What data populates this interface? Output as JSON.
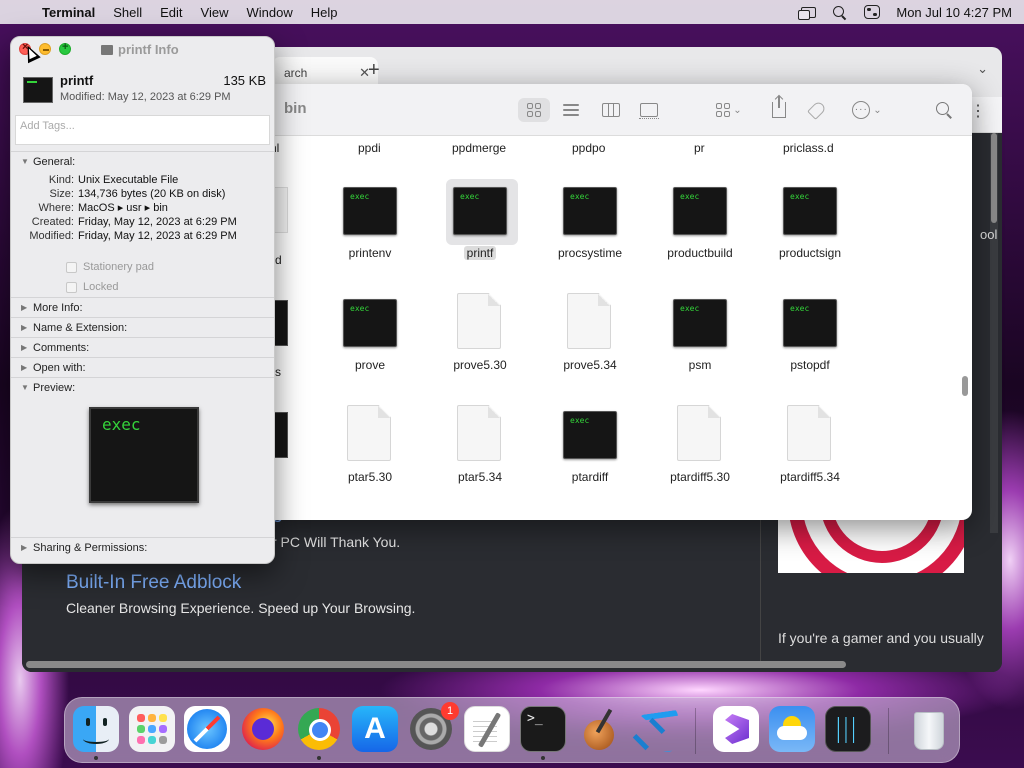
{
  "menubar": {
    "app": "Terminal",
    "items": [
      "Shell",
      "Edit",
      "View",
      "Window",
      "Help"
    ],
    "clock": "Mon Jul 10  4:27 PM"
  },
  "browser": {
    "tab_label": "arch",
    "ad_title_upper": "e",
    "ad_sub_upper": "r PC Will Thank You.",
    "ad_title": "Built-In Free Adblock",
    "ad_sub": "Cleaner Browsing Experience. Speed up Your Browsing.",
    "side_text": "If you're a gamer and you usually",
    "side_text_mid": "ool"
  },
  "finder": {
    "title": "bin",
    "row0_labels": [
      "nl",
      "ppdi",
      "ppdmerge",
      "ppdpo",
      "pr",
      "priclass.d"
    ],
    "items": [
      {
        "label": "printenv",
        "kind": "exec",
        "row": 1,
        "col": 0
      },
      {
        "label": "printf",
        "kind": "exec",
        "row": 1,
        "col": 1,
        "selected": true
      },
      {
        "label": "procsystime",
        "kind": "exec",
        "row": 1,
        "col": 2
      },
      {
        "label": "productbuild",
        "kind": "exec",
        "row": 1,
        "col": 3
      },
      {
        "label": "productsign",
        "kind": "exec",
        "row": 1,
        "col": 4
      },
      {
        "label": "prove",
        "kind": "exec",
        "row": 2,
        "col": 0
      },
      {
        "label": "prove5.30",
        "kind": "doc",
        "row": 2,
        "col": 1
      },
      {
        "label": "prove5.34",
        "kind": "doc",
        "row": 2,
        "col": 2
      },
      {
        "label": "psm",
        "kind": "exec",
        "row": 2,
        "col": 3
      },
      {
        "label": "pstopdf",
        "kind": "exec",
        "row": 2,
        "col": 4
      },
      {
        "label": "ptar5.30",
        "kind": "doc",
        "row": 3,
        "col": 0
      },
      {
        "label": "ptar5.34",
        "kind": "doc",
        "row": 3,
        "col": 1
      },
      {
        "label": "ptardiff",
        "kind": "exec",
        "row": 3,
        "col": 2
      },
      {
        "label": "ptardiff5.30",
        "kind": "doc",
        "row": 3,
        "col": 3
      },
      {
        "label": "ptardiff5.34",
        "kind": "doc",
        "row": 3,
        "col": 4
      }
    ],
    "partial_labels": [
      "d",
      "s"
    ],
    "exec_text": "exec"
  },
  "info": {
    "window_title": "printf Info",
    "name": "printf",
    "size": "135 KB",
    "modified_line": "Modified: May 12, 2023 at 6:29 PM",
    "tags_placeholder": "Add Tags...",
    "general_label": "General:",
    "general": [
      {
        "k": "Kind:",
        "v": "Unix Executable File"
      },
      {
        "k": "Size:",
        "v": "134,736 bytes (20 KB on disk)"
      },
      {
        "k": "Where:",
        "v": "MacOS ▸ usr ▸ bin"
      },
      {
        "k": "Created:",
        "v": "Friday, May 12, 2023 at 6:29 PM"
      },
      {
        "k": "Modified:",
        "v": "Friday, May 12, 2023 at 6:29 PM"
      }
    ],
    "stationery": "Stationery pad",
    "locked": "Locked",
    "more_info": "More Info:",
    "name_ext": "Name & Extension:",
    "comments": "Comments:",
    "open_with": "Open with:",
    "preview": "Preview:",
    "preview_text": "exec",
    "sharing": "Sharing & Permissions:"
  },
  "dock": {
    "settings_badge": "1",
    "terminal_prompt": ">_"
  },
  "colors": {
    "exec_green": "#34d33a",
    "link_blue": "#7fb2ff",
    "close_red": "#ff5f57",
    "min_yellow": "#febc2e",
    "max_green": "#28c840"
  }
}
